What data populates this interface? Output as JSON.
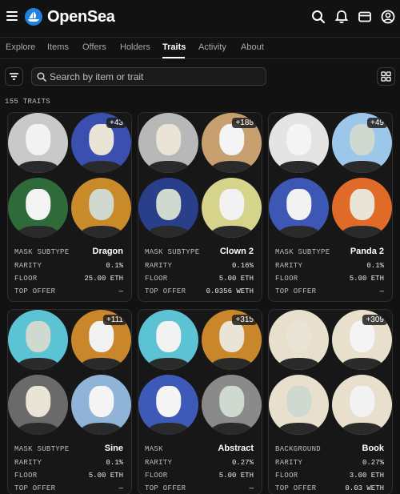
{
  "header": {
    "brand": "OpenSea"
  },
  "tabs": [
    {
      "label": "Explore"
    },
    {
      "label": "Items"
    },
    {
      "label": "Offers"
    },
    {
      "label": "Holders"
    },
    {
      "label": "Traits",
      "active": true
    },
    {
      "label": "Activity"
    },
    {
      "label": "About"
    }
  ],
  "search": {
    "placeholder": "Search by item or trait"
  },
  "traits_count": "155 TRAITS",
  "labels": {
    "rarity": "RARITY",
    "floor": "FLOOR",
    "top_offer": "TOP OFFER"
  },
  "cards": [
    {
      "type": "MASK SUBTYPE",
      "name": "Dragon",
      "rarity": "0.1%",
      "floor": "25.00 ETH",
      "top_offer": "—",
      "badge": "+43",
      "thumbs": [
        "#c9c9c9",
        "#3a4fb0",
        "#2f6a3a",
        "#c98a2a"
      ]
    },
    {
      "type": "MASK SUBTYPE",
      "name": "Clown 2",
      "rarity": "0.16%",
      "floor": "5.00 ETH",
      "top_offer": "0.0356 WETH",
      "badge": "+188",
      "thumbs": [
        "#b8b8b8",
        "#c8a070",
        "#2a3f8a",
        "#d6d48a"
      ]
    },
    {
      "type": "MASK SUBTYPE",
      "name": "Panda 2",
      "rarity": "0.1%",
      "floor": "5.00 ETH",
      "top_offer": "—",
      "badge": "+49",
      "thumbs": [
        "#e4e4e4",
        "#9cc7ea",
        "#3c58b4",
        "#e06a28"
      ]
    },
    {
      "type": "MASK SUBTYPE",
      "name": "Sine",
      "rarity": "0.1%",
      "floor": "5.00 ETH",
      "top_offer": "—",
      "badge": "+111",
      "thumbs": [
        "#5cc3d4",
        "#c9862a",
        "#6a6a6a",
        "#8fb4d8"
      ]
    },
    {
      "type": "MASK",
      "name": "Abstract",
      "rarity": "0.27%",
      "floor": "5.00 ETH",
      "top_offer": "—",
      "badge": "+315",
      "thumbs": [
        "#5cc3d4",
        "#c9862a",
        "#3e5ab8",
        "#8a8a8a"
      ]
    },
    {
      "type": "BACKGROUND",
      "name": "Book",
      "rarity": "0.27%",
      "floor": "3.00 ETH",
      "top_offer": "0.03 WETH",
      "badge": "+309",
      "thumbs": [
        "#e8e0cc",
        "#e8e0cc",
        "#e8e0cc",
        "#e8e0cc"
      ]
    }
  ]
}
